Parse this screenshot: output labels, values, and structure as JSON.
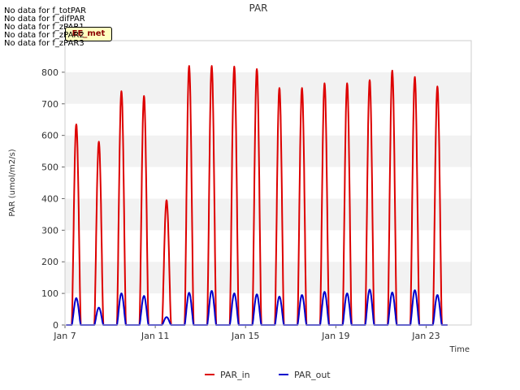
{
  "chart_data": {
    "type": "line",
    "title": "PAR",
    "xlabel": "Time",
    "ylabel": "PAR (umol/m2/s)",
    "ylim": [
      0,
      900
    ],
    "yticks": [
      0,
      100,
      200,
      300,
      400,
      500,
      600,
      700,
      800
    ],
    "xlim": [
      "2023-01-07",
      "2023-01-25"
    ],
    "xticks": [
      {
        "date": "2023-01-07",
        "label": "Jan 7"
      },
      {
        "date": "2023-01-11",
        "label": "Jan 11"
      },
      {
        "date": "2023-01-15",
        "label": "Jan 15"
      },
      {
        "date": "2023-01-19",
        "label": "Jan 19"
      },
      {
        "date": "2023-01-23",
        "label": "Jan 23"
      }
    ],
    "grid": "horizontal alternating bands",
    "legend_position": "bottom",
    "series": [
      {
        "name": "PAR_in",
        "color": "#dd0000",
        "daily_peaks": [
          {
            "date": "2023-01-07",
            "peak": 635
          },
          {
            "date": "2023-01-08",
            "peak": 580
          },
          {
            "date": "2023-01-09",
            "peak": 740
          },
          {
            "date": "2023-01-10",
            "peak": 725
          },
          {
            "date": "2023-01-11",
            "peak": 395
          },
          {
            "date": "2023-01-12",
            "peak": 820
          },
          {
            "date": "2023-01-13",
            "peak": 820
          },
          {
            "date": "2023-01-14",
            "peak": 818
          },
          {
            "date": "2023-01-15",
            "peak": 810
          },
          {
            "date": "2023-01-16",
            "peak": 750
          },
          {
            "date": "2023-01-17",
            "peak": 750
          },
          {
            "date": "2023-01-18",
            "peak": 765
          },
          {
            "date": "2023-01-19",
            "peak": 765
          },
          {
            "date": "2023-01-20",
            "peak": 775
          },
          {
            "date": "2023-01-21",
            "peak": 805
          },
          {
            "date": "2023-01-22",
            "peak": 785
          },
          {
            "date": "2023-01-23",
            "peak": 755
          }
        ]
      },
      {
        "name": "PAR_out",
        "color": "#0000cc",
        "daily_peaks": [
          {
            "date": "2023-01-07",
            "peak": 85
          },
          {
            "date": "2023-01-08",
            "peak": 55
          },
          {
            "date": "2023-01-09",
            "peak": 100
          },
          {
            "date": "2023-01-10",
            "peak": 92
          },
          {
            "date": "2023-01-11",
            "peak": 25
          },
          {
            "date": "2023-01-12",
            "peak": 102
          },
          {
            "date": "2023-01-13",
            "peak": 108
          },
          {
            "date": "2023-01-14",
            "peak": 100
          },
          {
            "date": "2023-01-15",
            "peak": 97
          },
          {
            "date": "2023-01-16",
            "peak": 90
          },
          {
            "date": "2023-01-17",
            "peak": 95
          },
          {
            "date": "2023-01-18",
            "peak": 105
          },
          {
            "date": "2023-01-19",
            "peak": 100
          },
          {
            "date": "2023-01-20",
            "peak": 112
          },
          {
            "date": "2023-01-21",
            "peak": 103
          },
          {
            "date": "2023-01-22",
            "peak": 110
          },
          {
            "date": "2023-01-23",
            "peak": 95
          }
        ]
      }
    ]
  },
  "no_data_messages": [
    "No data for f_totPAR",
    "No data for f_difPAR",
    "No data for f_zPAR1",
    "No data for f_zPAR2",
    "No data for f_zPAR3"
  ],
  "badge_text": "EE_met"
}
